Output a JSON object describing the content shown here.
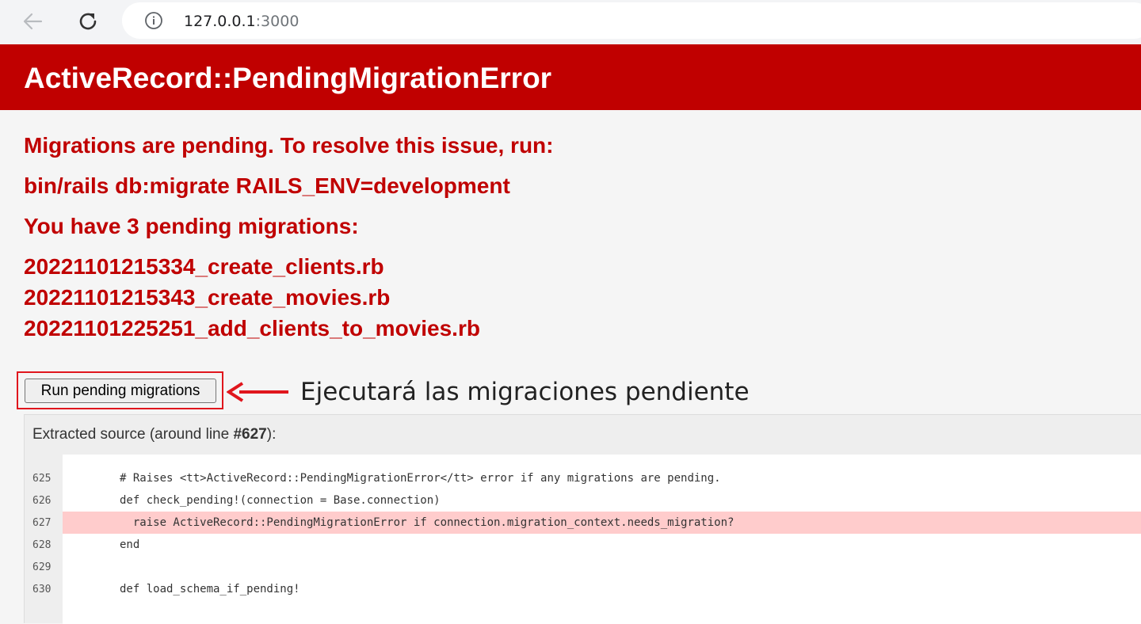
{
  "browser": {
    "url_host": "127.0.0.1",
    "url_port": ":3000",
    "icons": [
      "back-arrow-icon",
      "reload-icon",
      "info-icon"
    ]
  },
  "error": {
    "title": "ActiveRecord::PendingMigrationError",
    "message": "Migrations are pending. To resolve this issue, run:",
    "command": "bin/rails db:migrate RAILS_ENV=development",
    "pending_count_text": "You have 3 pending migrations:",
    "migrations": [
      "20221101215334_create_clients.rb",
      "20221101215343_create_movies.rb",
      "20221101225251_add_clients_to_movies.rb"
    ]
  },
  "action": {
    "button_label": "Run pending migrations",
    "annotation": "Ejecutará las migraciones pendiente"
  },
  "source": {
    "header_prefix": "Extracted source (around line ",
    "header_line": "#627",
    "header_suffix": "):",
    "lines": [
      {
        "no": "625",
        "code": "# Raises <tt>ActiveRecord::PendingMigrationError</tt> error if any migrations are pending."
      },
      {
        "no": "626",
        "code": "def check_pending!(connection = Base.connection)"
      },
      {
        "no": "627",
        "code": "  raise ActiveRecord::PendingMigrationError if connection.migration_context.needs_migration?"
      },
      {
        "no": "628",
        "code": "end"
      },
      {
        "no": "629",
        "code": ""
      },
      {
        "no": "630",
        "code": "def load_schema_if_pending!"
      }
    ],
    "highlighted_line": "627"
  },
  "colors": {
    "error_red": "#c00000",
    "annotation_red": "#e0161d",
    "highlight_row": "#ffcccc"
  }
}
